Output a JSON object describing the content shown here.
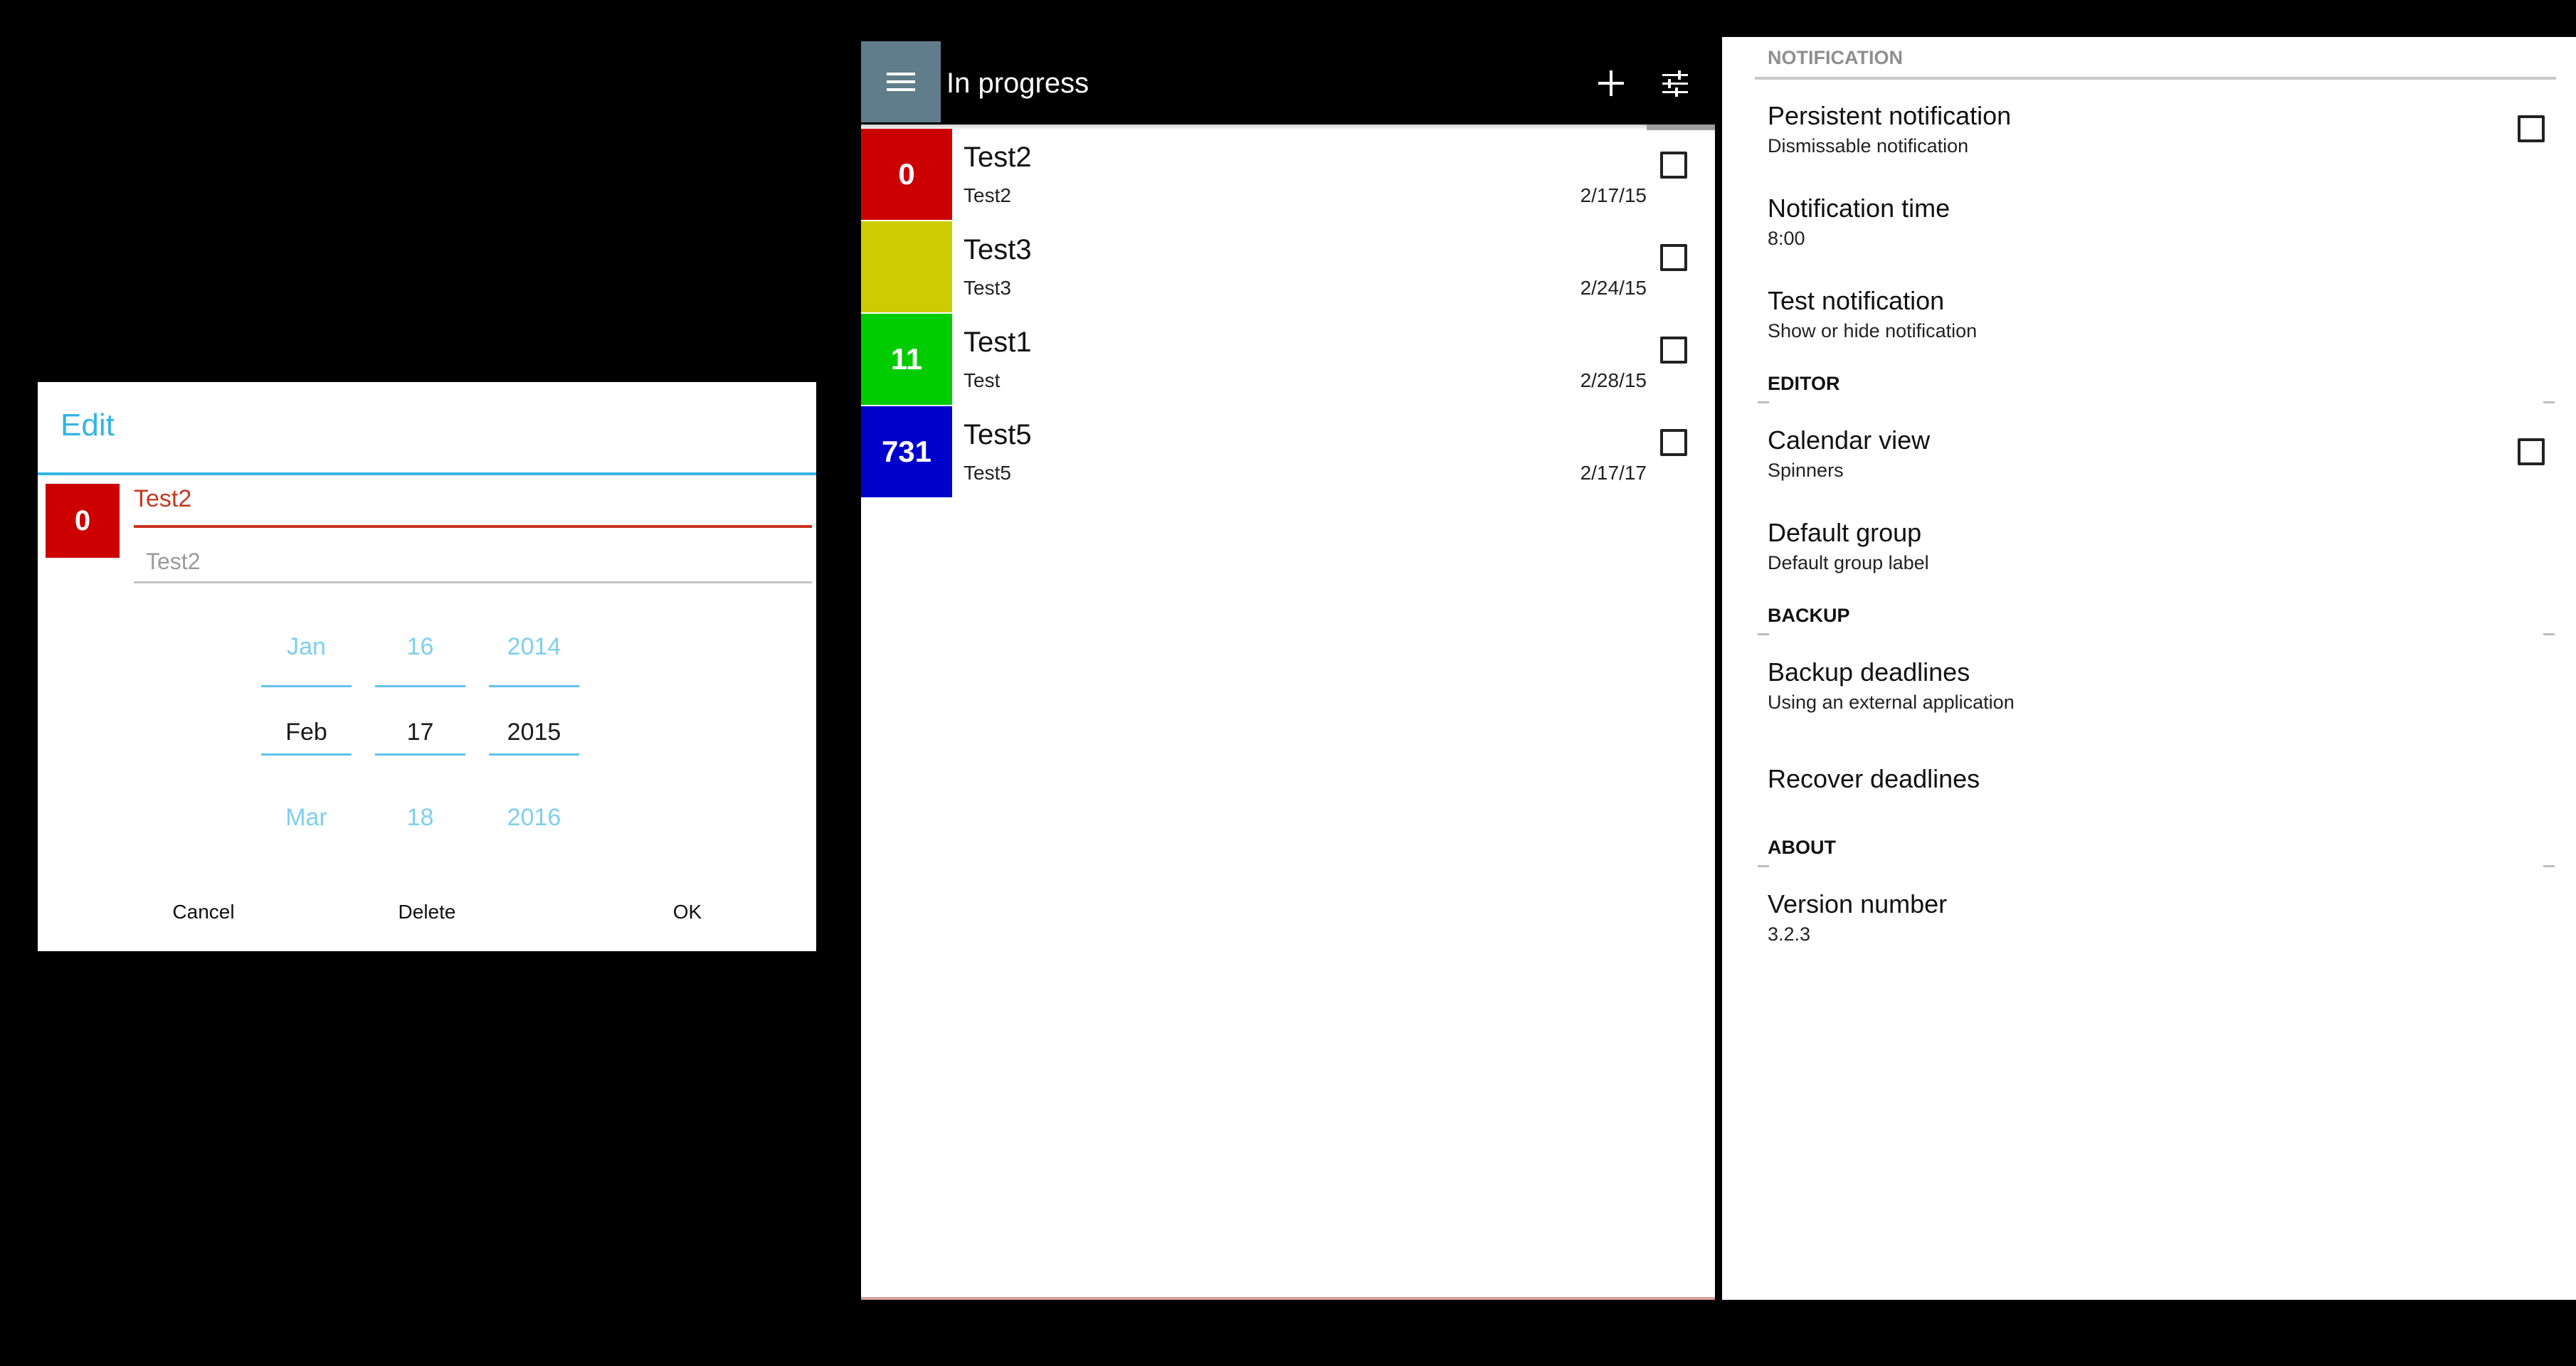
{
  "edit_dialog": {
    "title": "Edit",
    "badge": {
      "value": "0",
      "color": "#cc0000"
    },
    "name_value": "Test2",
    "description_placeholder": "Test2",
    "date_picker": {
      "month": {
        "prev": "Jan",
        "selected": "Feb",
        "next": "Mar"
      },
      "day": {
        "prev": "16",
        "selected": "17",
        "next": "18"
      },
      "year": {
        "prev": "2014",
        "selected": "2015",
        "next": "2016"
      }
    },
    "buttons": {
      "cancel": "Cancel",
      "delete": "Delete",
      "ok": "OK"
    }
  },
  "list_screen": {
    "title": "In progress",
    "icons": {
      "menu": "menu-icon",
      "add": "plus-icon",
      "filter": "tune-icon"
    },
    "items": [
      {
        "badge": "0",
        "color": "#cc0000",
        "title": "Test2",
        "subtitle": "Test2",
        "date": "2/17/15",
        "checked": false
      },
      {
        "badge": "",
        "color": "#cccc00",
        "title": "Test3",
        "subtitle": "Test3",
        "date": "2/24/15",
        "checked": false
      },
      {
        "badge": "11",
        "color": "#00cc00",
        "title": "Test1",
        "subtitle": "Test",
        "date": "2/28/15",
        "checked": false
      },
      {
        "badge": "731",
        "color": "#0000cc",
        "title": "Test5",
        "subtitle": "Test5",
        "date": "2/17/17",
        "checked": false
      }
    ]
  },
  "settings_screen": {
    "sections": {
      "notification": "NOTIFICATION",
      "editor": "EDITOR",
      "backup": "BACKUP",
      "about": "ABOUT"
    },
    "prefs": {
      "persistent_notification": {
        "title": "Persistent notification",
        "summary": "Dismissable notification",
        "checked": false
      },
      "notification_time": {
        "title": "Notification time",
        "summary": "8:00"
      },
      "test_notification": {
        "title": "Test notification",
        "summary": "Show or hide notification"
      },
      "calendar_view": {
        "title": "Calendar view",
        "summary": "Spinners",
        "checked": false
      },
      "default_group": {
        "title": "Default group",
        "summary": "Default group label"
      },
      "backup_deadlines": {
        "title": "Backup deadlines",
        "summary": "Using an external application"
      },
      "recover_deadlines": {
        "title": "Recover deadlines"
      },
      "version_number": {
        "title": "Version number",
        "summary": "3.2.3"
      }
    }
  }
}
